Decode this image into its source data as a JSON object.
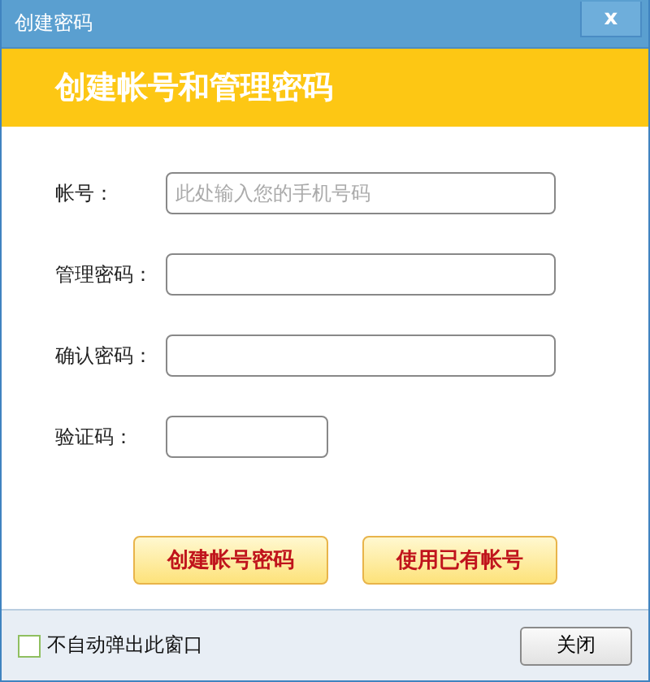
{
  "window": {
    "title": "创建密码",
    "close": "x"
  },
  "banner": {
    "title": "创建帐号和管理密码"
  },
  "fields": [
    {
      "label": "帐号：",
      "placeholder": "此处输入您的手机号码",
      "kind": "wide"
    },
    {
      "label": "管理密码：",
      "kind": "wide"
    },
    {
      "label": "确认密码：",
      "kind": "wide"
    },
    {
      "label": "验证码：",
      "kind": "short"
    }
  ],
  "buttons": [
    "创建帐号密码",
    "使用已有帐号"
  ],
  "footer": {
    "checkbox": {
      "label": "不自动弹出此窗口",
      "checked": false
    },
    "close_button": "关闭"
  }
}
